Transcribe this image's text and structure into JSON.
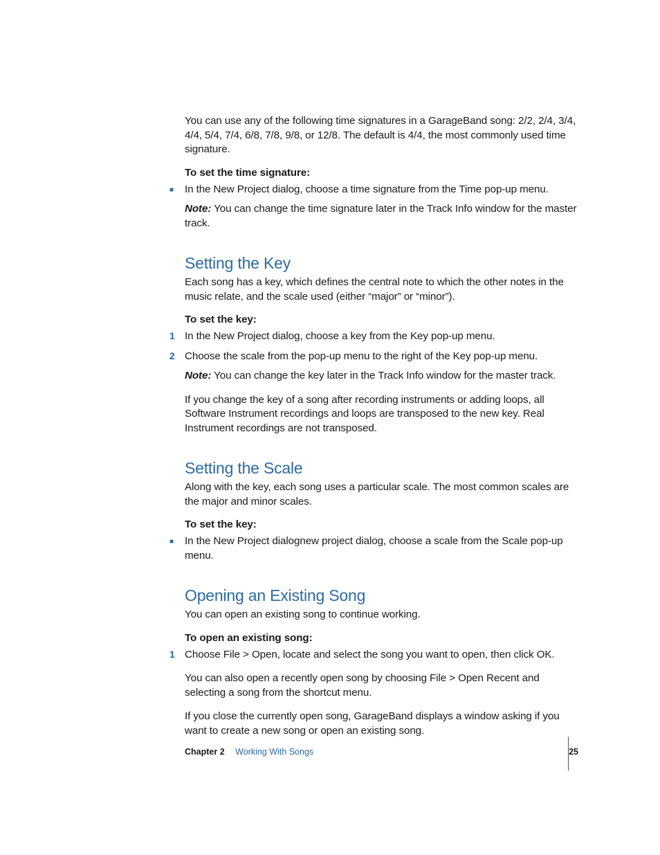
{
  "intro": {
    "p1": "You can use any of the following time signatures in a GarageBand song: 2/2, 2/4, 3/4, 4/4, 5/4, 7/4, 6/8, 7/8, 9/8, or 12/8. The default is 4/4, the most commonly used time signature.",
    "inst_title": "To set the time signature:",
    "step1": "In the New Project dialog, choose a time signature from the Time pop-up menu.",
    "note_label": "Note:",
    "note_text": "  You can change the time signature later in the Track Info window for the master track."
  },
  "key": {
    "heading": "Setting the Key",
    "p1": "Each song has a key, which defines the central note to which the other notes in the music relate, and the scale used (either “major” or “minor”).",
    "inst_title": "To set the key:",
    "step1": "In the New Project dialog, choose a key from the Key pop-up menu.",
    "step2": "Choose the scale from the pop-up menu to the right of the Key pop-up menu.",
    "note_label": "Note:",
    "note_text": "  You can change the key later in the Track Info window for the master track.",
    "p2": "If you change the key of a song after recording instruments or adding loops, all Software Instrument recordings and loops are transposed to the new key. Real Instrument recordings are not transposed."
  },
  "scale": {
    "heading": "Setting the Scale",
    "p1": "Along with the key, each song uses a particular scale. The most common scales are the major and minor scales.",
    "inst_title": "To set the key:",
    "step1": "In the New Project dialognew project dialog, choose a scale from the Scale pop-up menu."
  },
  "open": {
    "heading": "Opening an Existing Song",
    "p1": "You can open an existing song to continue working.",
    "inst_title": "To open an existing song:",
    "step1": "Choose File > Open, locate and select the song you want to open, then click OK.",
    "p2": "You can also open a recently open song by choosing File > Open Recent and selecting a song from the shortcut menu.",
    "p3": "If you close the currently open song, GarageBand displays a window asking if you want to create a new song or open an existing song."
  },
  "footer": {
    "chapter_label": "Chapter 2",
    "chapter_name": "Working With Songs",
    "page_number": "25"
  }
}
